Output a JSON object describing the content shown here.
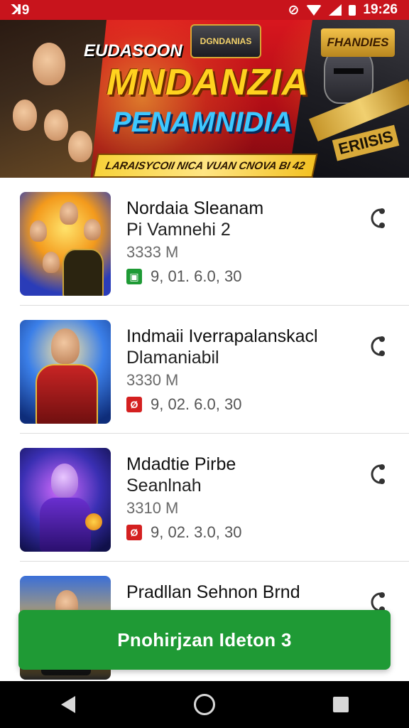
{
  "status_bar": {
    "left_text": "ꓘ9",
    "time": "19:26",
    "icons": [
      "mute-icon",
      "wifi-icon",
      "signal-icon",
      "battery-icon"
    ]
  },
  "banner": {
    "small_text": "EUDASOON",
    "badge_left": "DGNDANIAS",
    "badge_right": "FHANDIES",
    "title_line1": "MNDANZIA",
    "title_line2": "PENAMNIDIA",
    "ribbon": "LARAISYCOII NICA VUAN CNOVA BI 42",
    "right_tag": "ERIISIS"
  },
  "apps": [
    {
      "title": "Nordaia Sleanam",
      "subtitle": "Pi Vamnehi 2",
      "size": "3333 M",
      "meta": "9, 01.  6.0,  30",
      "meta_icon": "green-badge-icon",
      "meta_color": "#1e9a35"
    },
    {
      "title": "Indmaii Iverrapalanskacl",
      "subtitle": "Dlamaniabil",
      "size": "3330 M",
      "meta": "9, 02.  6.0,  30",
      "meta_icon": "red-badge-icon",
      "meta_color": "#d42020"
    },
    {
      "title": "Mdadtie Pirbe",
      "subtitle": "Seanlnah",
      "size": "3310 M",
      "meta": "9, 02.  3.0,  30",
      "meta_icon": "red-badge-icon",
      "meta_color": "#d42020"
    },
    {
      "title": "Pradllan Sehnon Brnd",
      "subtitle": "",
      "size": "",
      "meta": "",
      "meta_icon": "",
      "meta_color": ""
    }
  ],
  "install_button": {
    "label": "Pnohirjzan Ideton 3"
  },
  "colors": {
    "banner_red": "#c8141c",
    "primary_green": "#1f9a35",
    "navbar": "#000000"
  }
}
